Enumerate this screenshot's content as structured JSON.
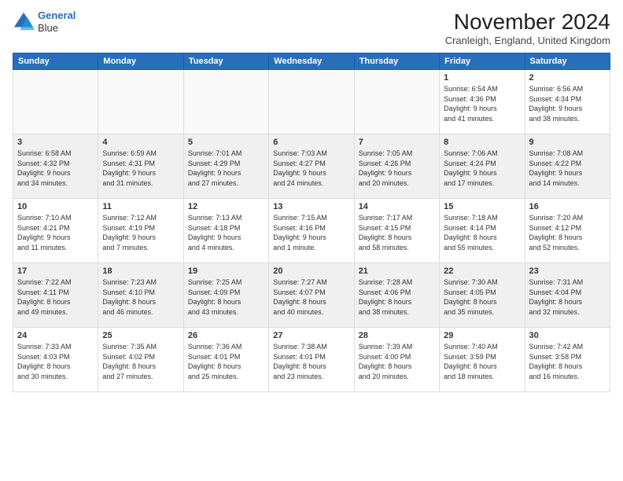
{
  "logo": {
    "line1": "General",
    "line2": "Blue"
  },
  "title": "November 2024",
  "location": "Cranleigh, England, United Kingdom",
  "headers": [
    "Sunday",
    "Monday",
    "Tuesday",
    "Wednesday",
    "Thursday",
    "Friday",
    "Saturday"
  ],
  "weeks": [
    [
      {
        "day": "",
        "info": ""
      },
      {
        "day": "",
        "info": ""
      },
      {
        "day": "",
        "info": ""
      },
      {
        "day": "",
        "info": ""
      },
      {
        "day": "",
        "info": ""
      },
      {
        "day": "1",
        "info": "Sunrise: 6:54 AM\nSunset: 4:36 PM\nDaylight: 9 hours\nand 41 minutes."
      },
      {
        "day": "2",
        "info": "Sunrise: 6:56 AM\nSunset: 4:34 PM\nDaylight: 9 hours\nand 38 minutes."
      }
    ],
    [
      {
        "day": "3",
        "info": "Sunrise: 6:58 AM\nSunset: 4:32 PM\nDaylight: 9 hours\nand 34 minutes."
      },
      {
        "day": "4",
        "info": "Sunrise: 6:59 AM\nSunset: 4:31 PM\nDaylight: 9 hours\nand 31 minutes."
      },
      {
        "day": "5",
        "info": "Sunrise: 7:01 AM\nSunset: 4:29 PM\nDaylight: 9 hours\nand 27 minutes."
      },
      {
        "day": "6",
        "info": "Sunrise: 7:03 AM\nSunset: 4:27 PM\nDaylight: 9 hours\nand 24 minutes."
      },
      {
        "day": "7",
        "info": "Sunrise: 7:05 AM\nSunset: 4:26 PM\nDaylight: 9 hours\nand 20 minutes."
      },
      {
        "day": "8",
        "info": "Sunrise: 7:06 AM\nSunset: 4:24 PM\nDaylight: 9 hours\nand 17 minutes."
      },
      {
        "day": "9",
        "info": "Sunrise: 7:08 AM\nSunset: 4:22 PM\nDaylight: 9 hours\nand 14 minutes."
      }
    ],
    [
      {
        "day": "10",
        "info": "Sunrise: 7:10 AM\nSunset: 4:21 PM\nDaylight: 9 hours\nand 11 minutes."
      },
      {
        "day": "11",
        "info": "Sunrise: 7:12 AM\nSunset: 4:19 PM\nDaylight: 9 hours\nand 7 minutes."
      },
      {
        "day": "12",
        "info": "Sunrise: 7:13 AM\nSunset: 4:18 PM\nDaylight: 9 hours\nand 4 minutes."
      },
      {
        "day": "13",
        "info": "Sunrise: 7:15 AM\nSunset: 4:16 PM\nDaylight: 9 hours\nand 1 minute."
      },
      {
        "day": "14",
        "info": "Sunrise: 7:17 AM\nSunset: 4:15 PM\nDaylight: 8 hours\nand 58 minutes."
      },
      {
        "day": "15",
        "info": "Sunrise: 7:18 AM\nSunset: 4:14 PM\nDaylight: 8 hours\nand 55 minutes."
      },
      {
        "day": "16",
        "info": "Sunrise: 7:20 AM\nSunset: 4:12 PM\nDaylight: 8 hours\nand 52 minutes."
      }
    ],
    [
      {
        "day": "17",
        "info": "Sunrise: 7:22 AM\nSunset: 4:11 PM\nDaylight: 8 hours\nand 49 minutes."
      },
      {
        "day": "18",
        "info": "Sunrise: 7:23 AM\nSunset: 4:10 PM\nDaylight: 8 hours\nand 46 minutes."
      },
      {
        "day": "19",
        "info": "Sunrise: 7:25 AM\nSunset: 4:09 PM\nDaylight: 8 hours\nand 43 minutes."
      },
      {
        "day": "20",
        "info": "Sunrise: 7:27 AM\nSunset: 4:07 PM\nDaylight: 8 hours\nand 40 minutes."
      },
      {
        "day": "21",
        "info": "Sunrise: 7:28 AM\nSunset: 4:06 PM\nDaylight: 8 hours\nand 38 minutes."
      },
      {
        "day": "22",
        "info": "Sunrise: 7:30 AM\nSunset: 4:05 PM\nDaylight: 8 hours\nand 35 minutes."
      },
      {
        "day": "23",
        "info": "Sunrise: 7:31 AM\nSunset: 4:04 PM\nDaylight: 8 hours\nand 32 minutes."
      }
    ],
    [
      {
        "day": "24",
        "info": "Sunrise: 7:33 AM\nSunset: 4:03 PM\nDaylight: 8 hours\nand 30 minutes."
      },
      {
        "day": "25",
        "info": "Sunrise: 7:35 AM\nSunset: 4:02 PM\nDaylight: 8 hours\nand 27 minutes."
      },
      {
        "day": "26",
        "info": "Sunrise: 7:36 AM\nSunset: 4:01 PM\nDaylight: 8 hours\nand 25 minutes."
      },
      {
        "day": "27",
        "info": "Sunrise: 7:38 AM\nSunset: 4:01 PM\nDaylight: 8 hours\nand 23 minutes."
      },
      {
        "day": "28",
        "info": "Sunrise: 7:39 AM\nSunset: 4:00 PM\nDaylight: 8 hours\nand 20 minutes."
      },
      {
        "day": "29",
        "info": "Sunrise: 7:40 AM\nSunset: 3:59 PM\nDaylight: 8 hours\nand 18 minutes."
      },
      {
        "day": "30",
        "info": "Sunrise: 7:42 AM\nSunset: 3:58 PM\nDaylight: 8 hours\nand 16 minutes."
      }
    ]
  ]
}
